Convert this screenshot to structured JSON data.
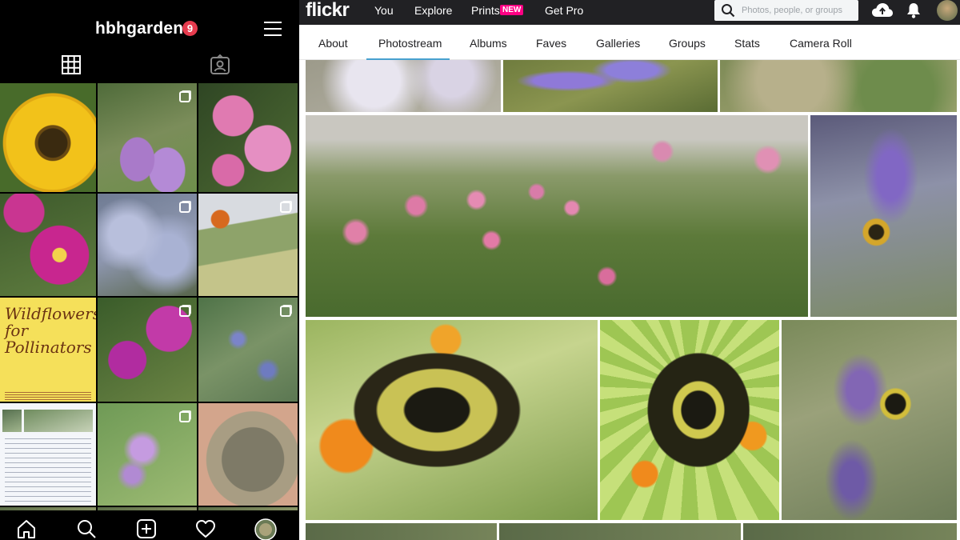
{
  "instagram": {
    "username": "hbhgarden",
    "notification_count": "9",
    "tabs": [
      {
        "icon": "grid-icon"
      },
      {
        "icon": "tagged-icon"
      }
    ],
    "poster": {
      "title": "Wildflowers for Pollinators"
    },
    "bottom_nav": [
      {
        "icon": "home-icon"
      },
      {
        "icon": "search-icon"
      },
      {
        "icon": "add-post-icon"
      },
      {
        "icon": "heart-icon"
      },
      {
        "icon": "profile-avatar-icon"
      }
    ]
  },
  "flickr": {
    "logo": "flickr",
    "nav": {
      "you": "You",
      "explore": "Explore",
      "prints": "Prints",
      "prints_badge": "NEW",
      "get_pro": "Get Pro"
    },
    "search": {
      "placeholder": "Photos, people, or groups"
    },
    "subnav": {
      "about": "About",
      "photostream": "Photostream",
      "albums": "Albums",
      "faves": "Faves",
      "galleries": "Galleries",
      "groups": "Groups",
      "stats": "Stats",
      "camera_roll": "Camera Roll"
    },
    "active_tab": "Photostream"
  },
  "colors": {
    "instagram_bg": "#000000",
    "notification_badge": "#e63b4e",
    "flickr_topbar": "#212124",
    "flickr_new_badge": "#ff0084",
    "flickr_active_underline": "#47a1cf"
  }
}
